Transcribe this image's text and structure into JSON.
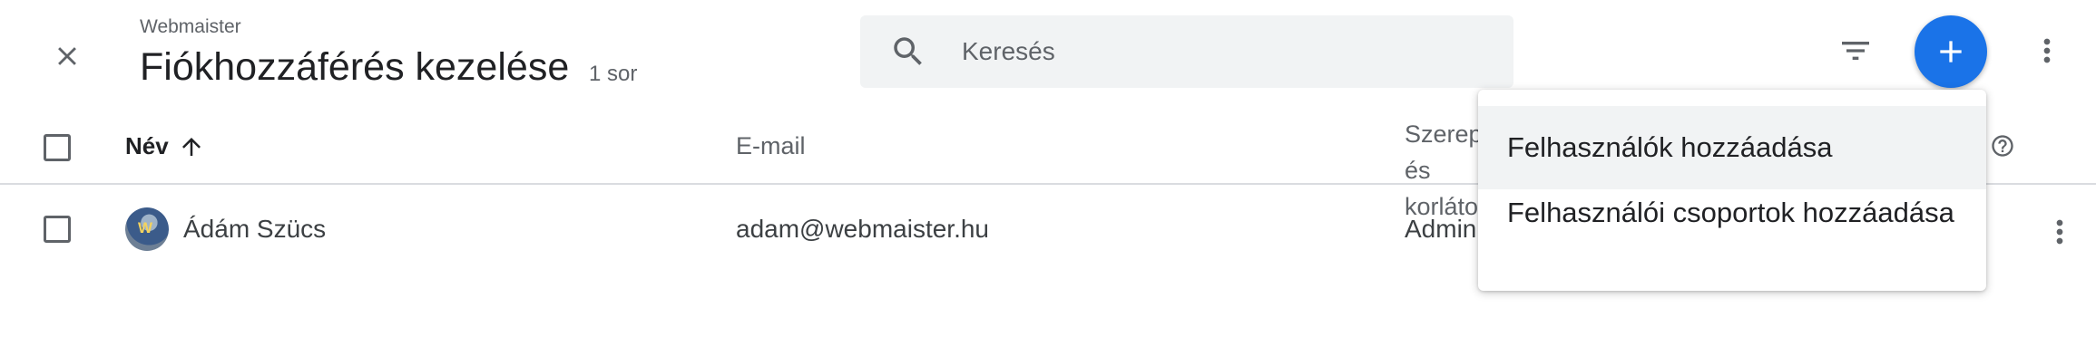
{
  "header": {
    "subtitle": "Webmaister",
    "title": "Fiókhozzáférés kezelése",
    "row_count": "1 sor"
  },
  "search": {
    "placeholder": "Keresés",
    "value": ""
  },
  "table": {
    "columns": {
      "name": "Név",
      "email": "E-mail",
      "role": "Szerepkörök és korlátozások"
    },
    "rows": [
      {
        "name": "Ádám Szücs",
        "email": "adam@webmaister.hu",
        "role": "Admin"
      }
    ]
  },
  "menu": {
    "items": [
      {
        "label": "Felhasználók hozzáadása"
      },
      {
        "label": "Felhasználói csoportok hozzáadása"
      }
    ]
  },
  "colors": {
    "accent": "#1a73e8",
    "divider": "#dadce0",
    "search_bg": "#f1f3f4"
  },
  "icons": {
    "close": "close-icon",
    "search": "search-icon",
    "filter": "filter-icon",
    "add": "plus-icon",
    "more": "more-vert-icon",
    "sort": "arrow-up-icon",
    "help": "help-icon"
  }
}
